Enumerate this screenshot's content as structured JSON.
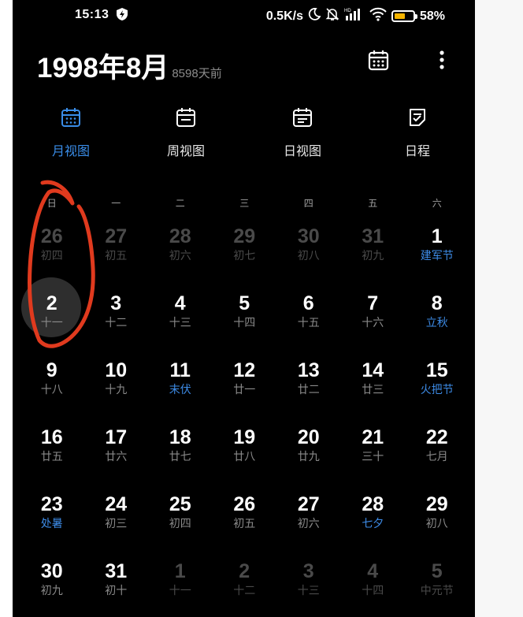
{
  "status_bar": {
    "time": "15:13",
    "speed": "0.5K/s",
    "hd": "HD",
    "battery": "58%"
  },
  "header": {
    "title": "1998年8月",
    "ago": "8598天前"
  },
  "tabs": [
    {
      "label": "月视图",
      "icon": "calendar-month-icon",
      "active": true
    },
    {
      "label": "周视图",
      "icon": "calendar-week-icon",
      "active": false
    },
    {
      "label": "日视图",
      "icon": "calendar-day-icon",
      "active": false
    },
    {
      "label": "日程",
      "icon": "schedule-icon",
      "active": false
    }
  ],
  "weekdays": [
    "日",
    "一",
    "二",
    "三",
    "四",
    "五",
    "六"
  ],
  "colors": {
    "accent": "#3a8de8",
    "background": "#000000",
    "annotation": "#e03a1e"
  },
  "days": [
    {
      "num": "26",
      "lunar": "初四",
      "dim": true
    },
    {
      "num": "27",
      "lunar": "初五",
      "dim": true
    },
    {
      "num": "28",
      "lunar": "初六",
      "dim": true
    },
    {
      "num": "29",
      "lunar": "初七",
      "dim": true
    },
    {
      "num": "30",
      "lunar": "初八",
      "dim": true
    },
    {
      "num": "31",
      "lunar": "初九",
      "dim": true
    },
    {
      "num": "1",
      "lunar": "建军节",
      "hl": true
    },
    {
      "num": "2",
      "lunar": "十一"
    },
    {
      "num": "3",
      "lunar": "十二"
    },
    {
      "num": "4",
      "lunar": "十三"
    },
    {
      "num": "5",
      "lunar": "十四"
    },
    {
      "num": "6",
      "lunar": "十五"
    },
    {
      "num": "7",
      "lunar": "十六"
    },
    {
      "num": "8",
      "lunar": "立秋",
      "hl": true
    },
    {
      "num": "9",
      "lunar": "十八"
    },
    {
      "num": "10",
      "lunar": "十九"
    },
    {
      "num": "11",
      "lunar": "末伏",
      "hl": true
    },
    {
      "num": "12",
      "lunar": "廿一"
    },
    {
      "num": "13",
      "lunar": "廿二"
    },
    {
      "num": "14",
      "lunar": "廿三"
    },
    {
      "num": "15",
      "lunar": "火把节",
      "hl": true
    },
    {
      "num": "16",
      "lunar": "廿五"
    },
    {
      "num": "17",
      "lunar": "廿六"
    },
    {
      "num": "18",
      "lunar": "廿七"
    },
    {
      "num": "19",
      "lunar": "廿八"
    },
    {
      "num": "20",
      "lunar": "廿九"
    },
    {
      "num": "21",
      "lunar": "三十"
    },
    {
      "num": "22",
      "lunar": "七月"
    },
    {
      "num": "23",
      "lunar": "处暑",
      "hl": true
    },
    {
      "num": "24",
      "lunar": "初三"
    },
    {
      "num": "25",
      "lunar": "初四"
    },
    {
      "num": "26",
      "lunar": "初五"
    },
    {
      "num": "27",
      "lunar": "初六"
    },
    {
      "num": "28",
      "lunar": "七夕",
      "hl": true
    },
    {
      "num": "29",
      "lunar": "初八"
    },
    {
      "num": "30",
      "lunar": "初九"
    },
    {
      "num": "31",
      "lunar": "初十"
    },
    {
      "num": "1",
      "lunar": "十一",
      "dim": true
    },
    {
      "num": "2",
      "lunar": "十二",
      "dim": true
    },
    {
      "num": "3",
      "lunar": "十三",
      "dim": true
    },
    {
      "num": "4",
      "lunar": "十四",
      "dim": true
    },
    {
      "num": "5",
      "lunar": "中元节",
      "dim": true
    }
  ]
}
